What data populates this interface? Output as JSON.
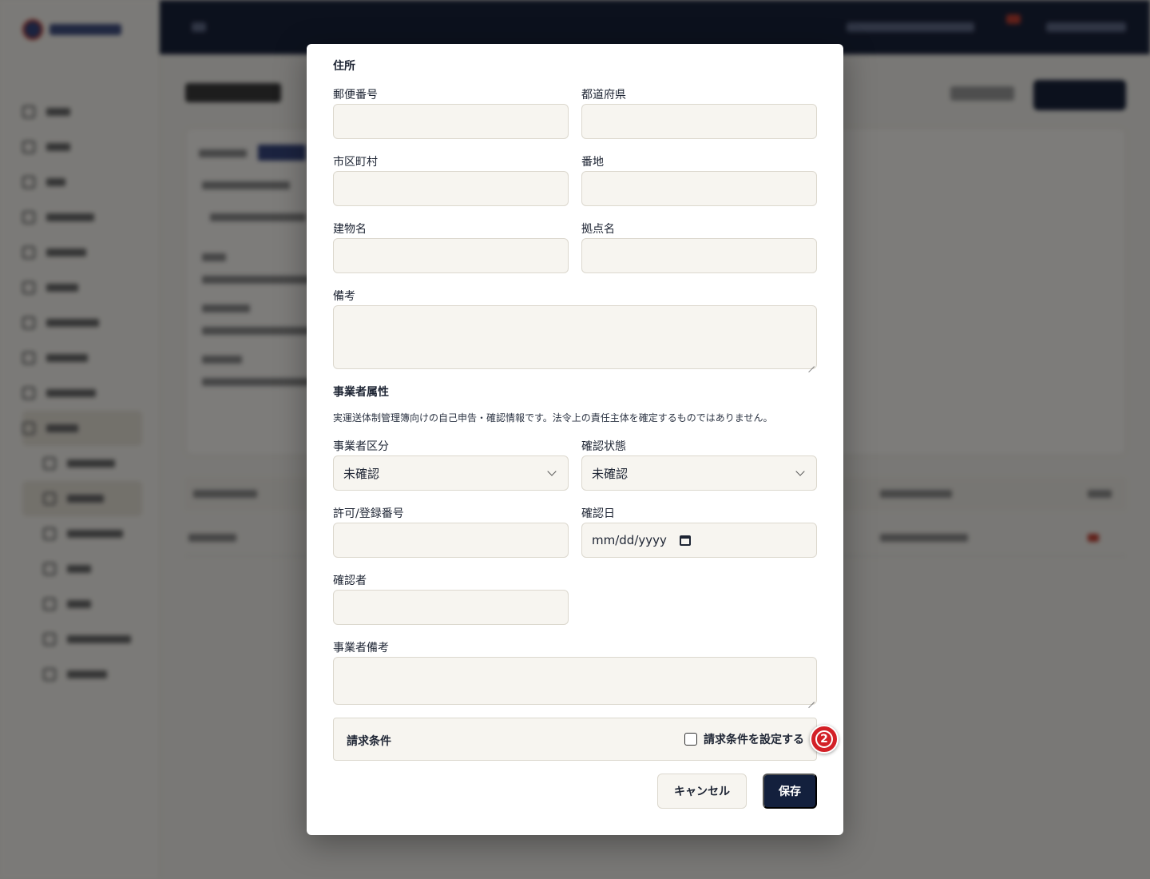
{
  "address_section": {
    "title": "住所",
    "postal_code_label": "郵便番号",
    "prefecture_label": "都道府県",
    "city_label": "市区町村",
    "street_label": "番地",
    "building_label": "建物名",
    "site_name_label": "拠点名",
    "remarks_label": "備考"
  },
  "operator_section": {
    "title": "事業者属性",
    "note": "実運送体制管理簿向けの自己申告・確認情報です。法令上の責任主体を確定するものではありません。",
    "category_label": "事業者区分",
    "category_value": "未確認",
    "status_label": "確認状態",
    "status_value": "未確認",
    "license_label": "許可/登録番号",
    "confirm_date_label": "確認日",
    "confirm_date_placeholder": "mm/dd/yyyy",
    "confirmer_label": "確認者",
    "operator_remarks_label": "事業者備考"
  },
  "billing": {
    "title": "請求条件",
    "checkbox_label": "請求条件を設定する",
    "checked": false
  },
  "buttons": {
    "cancel": "キャンセル",
    "save": "保存"
  },
  "annotation_marker": "2",
  "colors": {
    "primary": "#13203d",
    "field_bg": "#f7f5f0",
    "marker": "#d32027"
  }
}
